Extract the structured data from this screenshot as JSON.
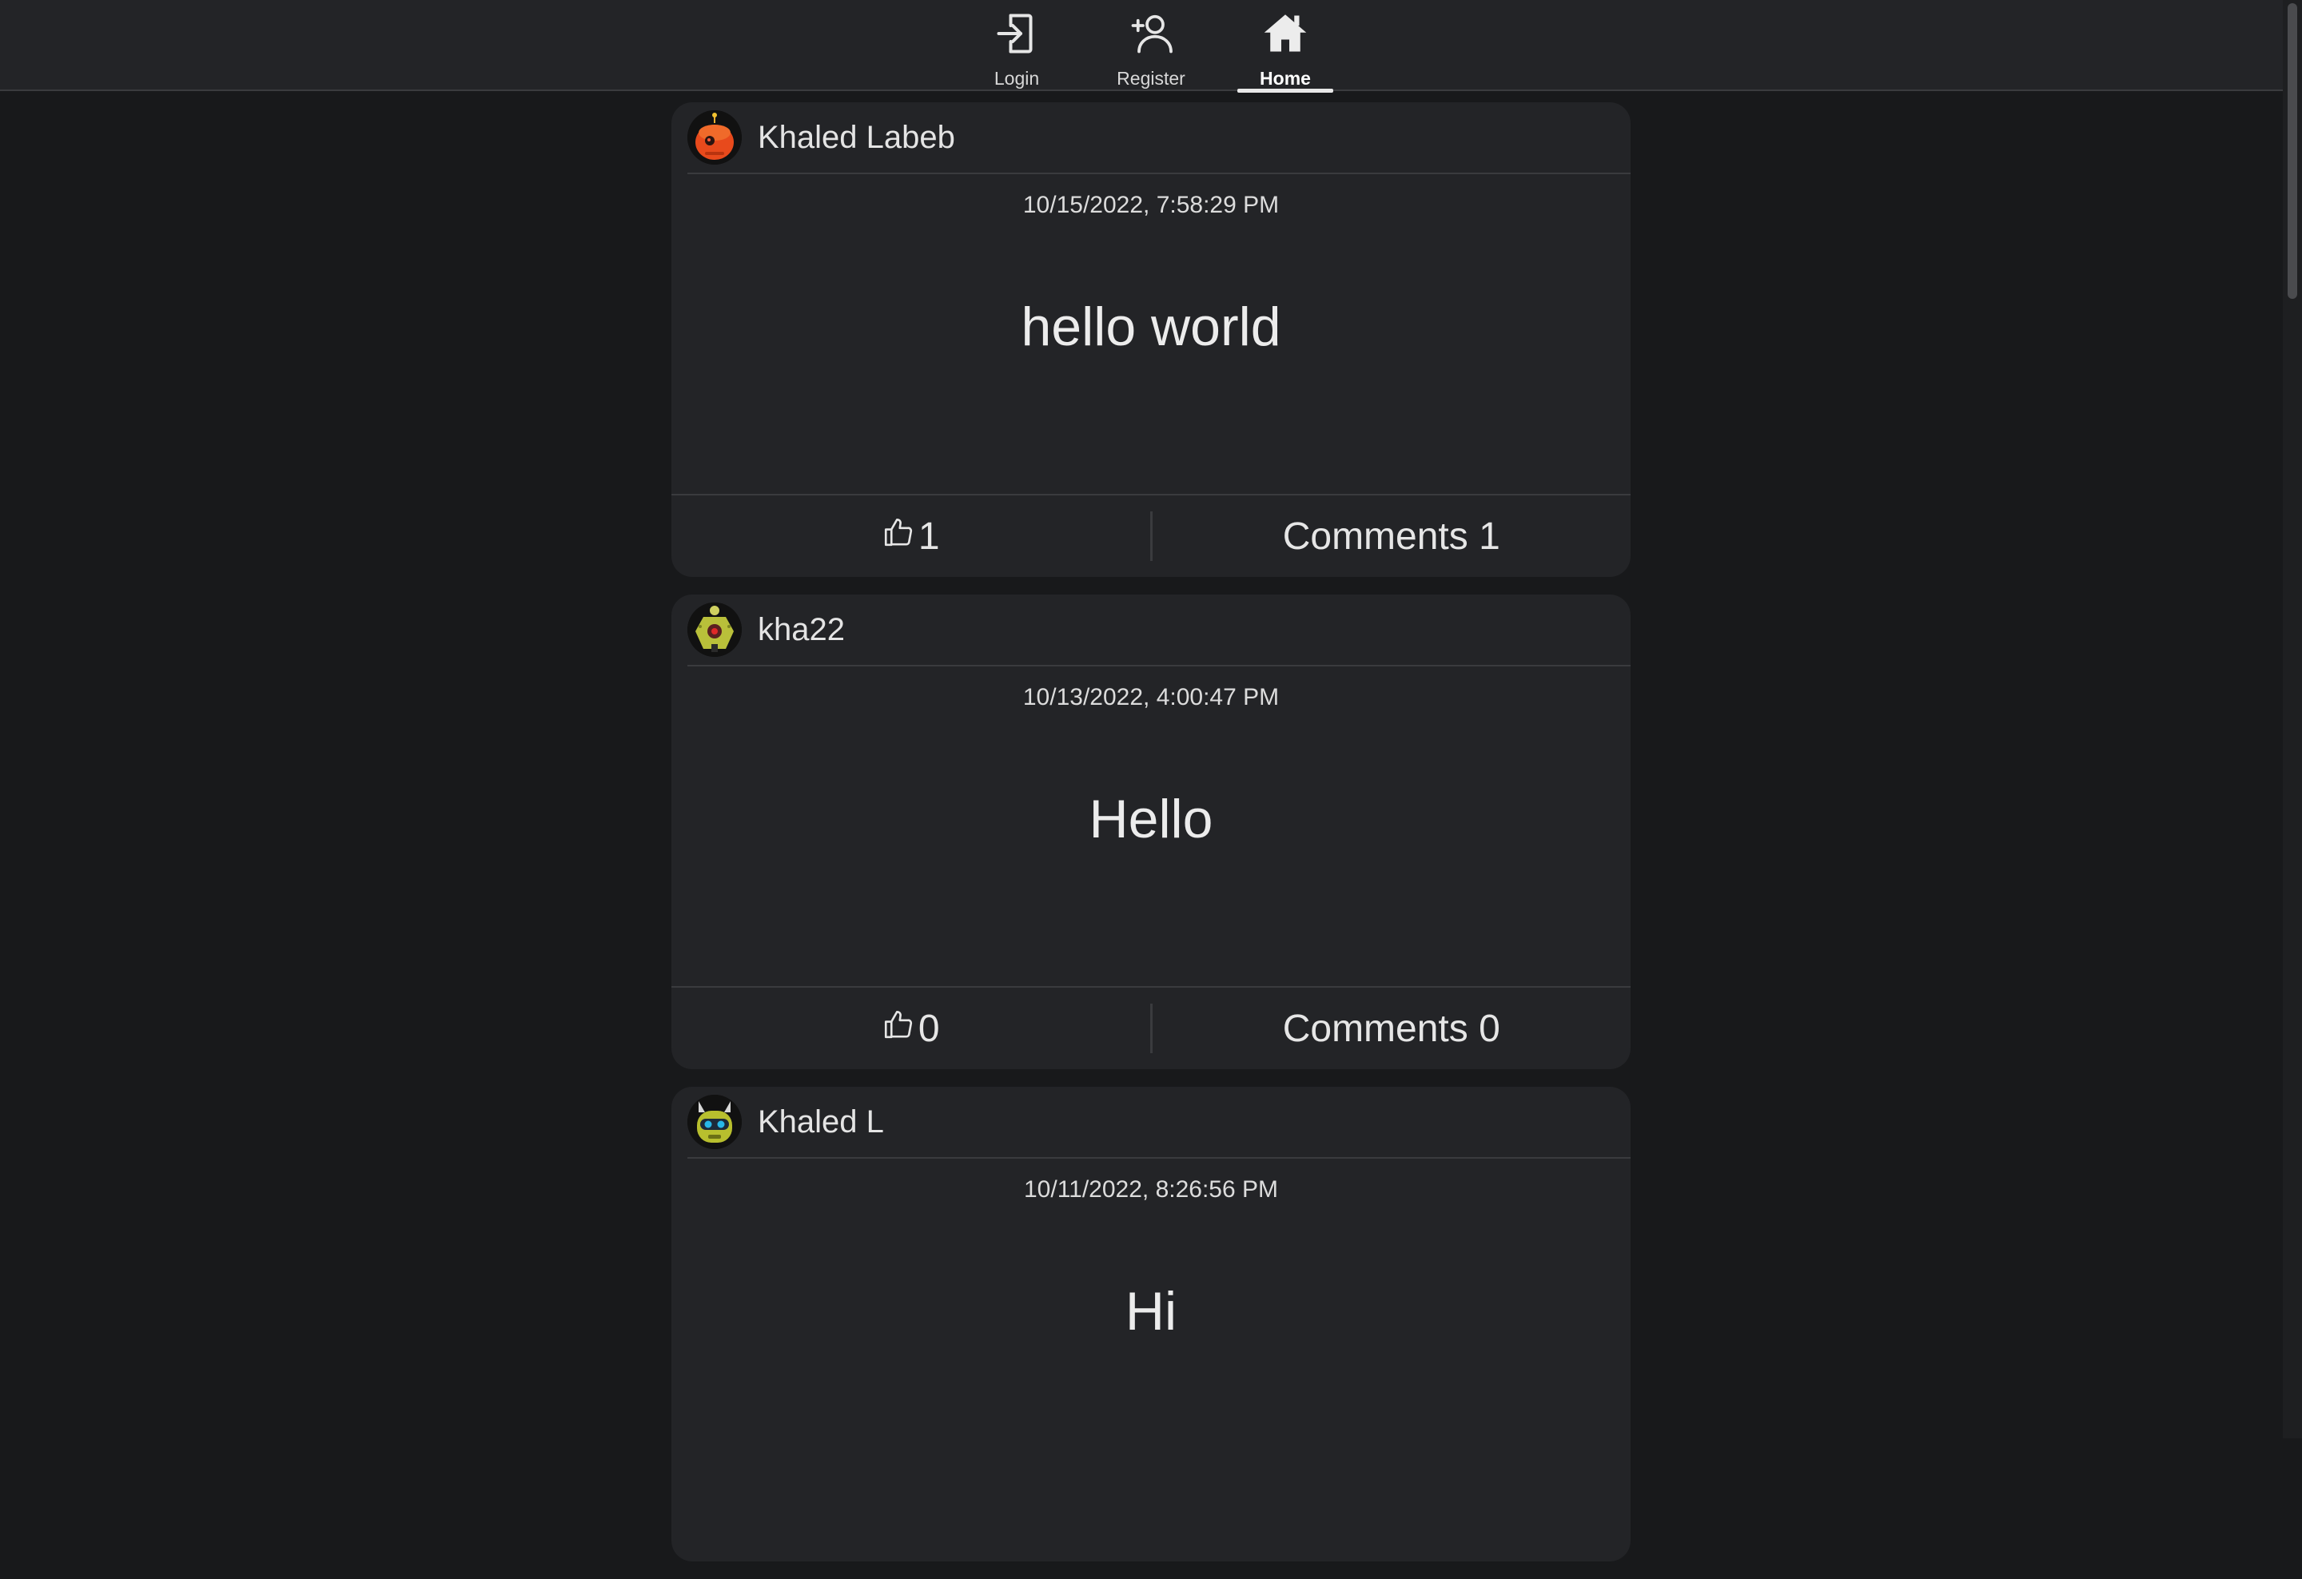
{
  "nav": {
    "items": [
      {
        "label": "Login",
        "icon": "login-icon"
      },
      {
        "label": "Register",
        "icon": "add-user-icon"
      },
      {
        "label": "Home",
        "icon": "home-icon",
        "active": true
      }
    ]
  },
  "posts": [
    {
      "author": "Khaled Labeb",
      "avatar": "orange-robot-avatar",
      "timestamp": "10/15/2022, 7:58:29 PM",
      "body": "hello world",
      "likes": "1",
      "comments_label": "Comments 1"
    },
    {
      "author": "kha22",
      "avatar": "yellow-green-robot-avatar",
      "timestamp": "10/13/2022, 4:00:47 PM",
      "body": "Hello",
      "likes": "0",
      "comments_label": "Comments 0"
    },
    {
      "author": "Khaled L",
      "avatar": "green-robot-avatar",
      "timestamp": "10/11/2022, 8:26:56 PM",
      "body": "Hi"
    }
  ],
  "colors": {
    "page_bg": "#18191b",
    "card_bg": "#232427",
    "border": "#3a3b3e"
  }
}
